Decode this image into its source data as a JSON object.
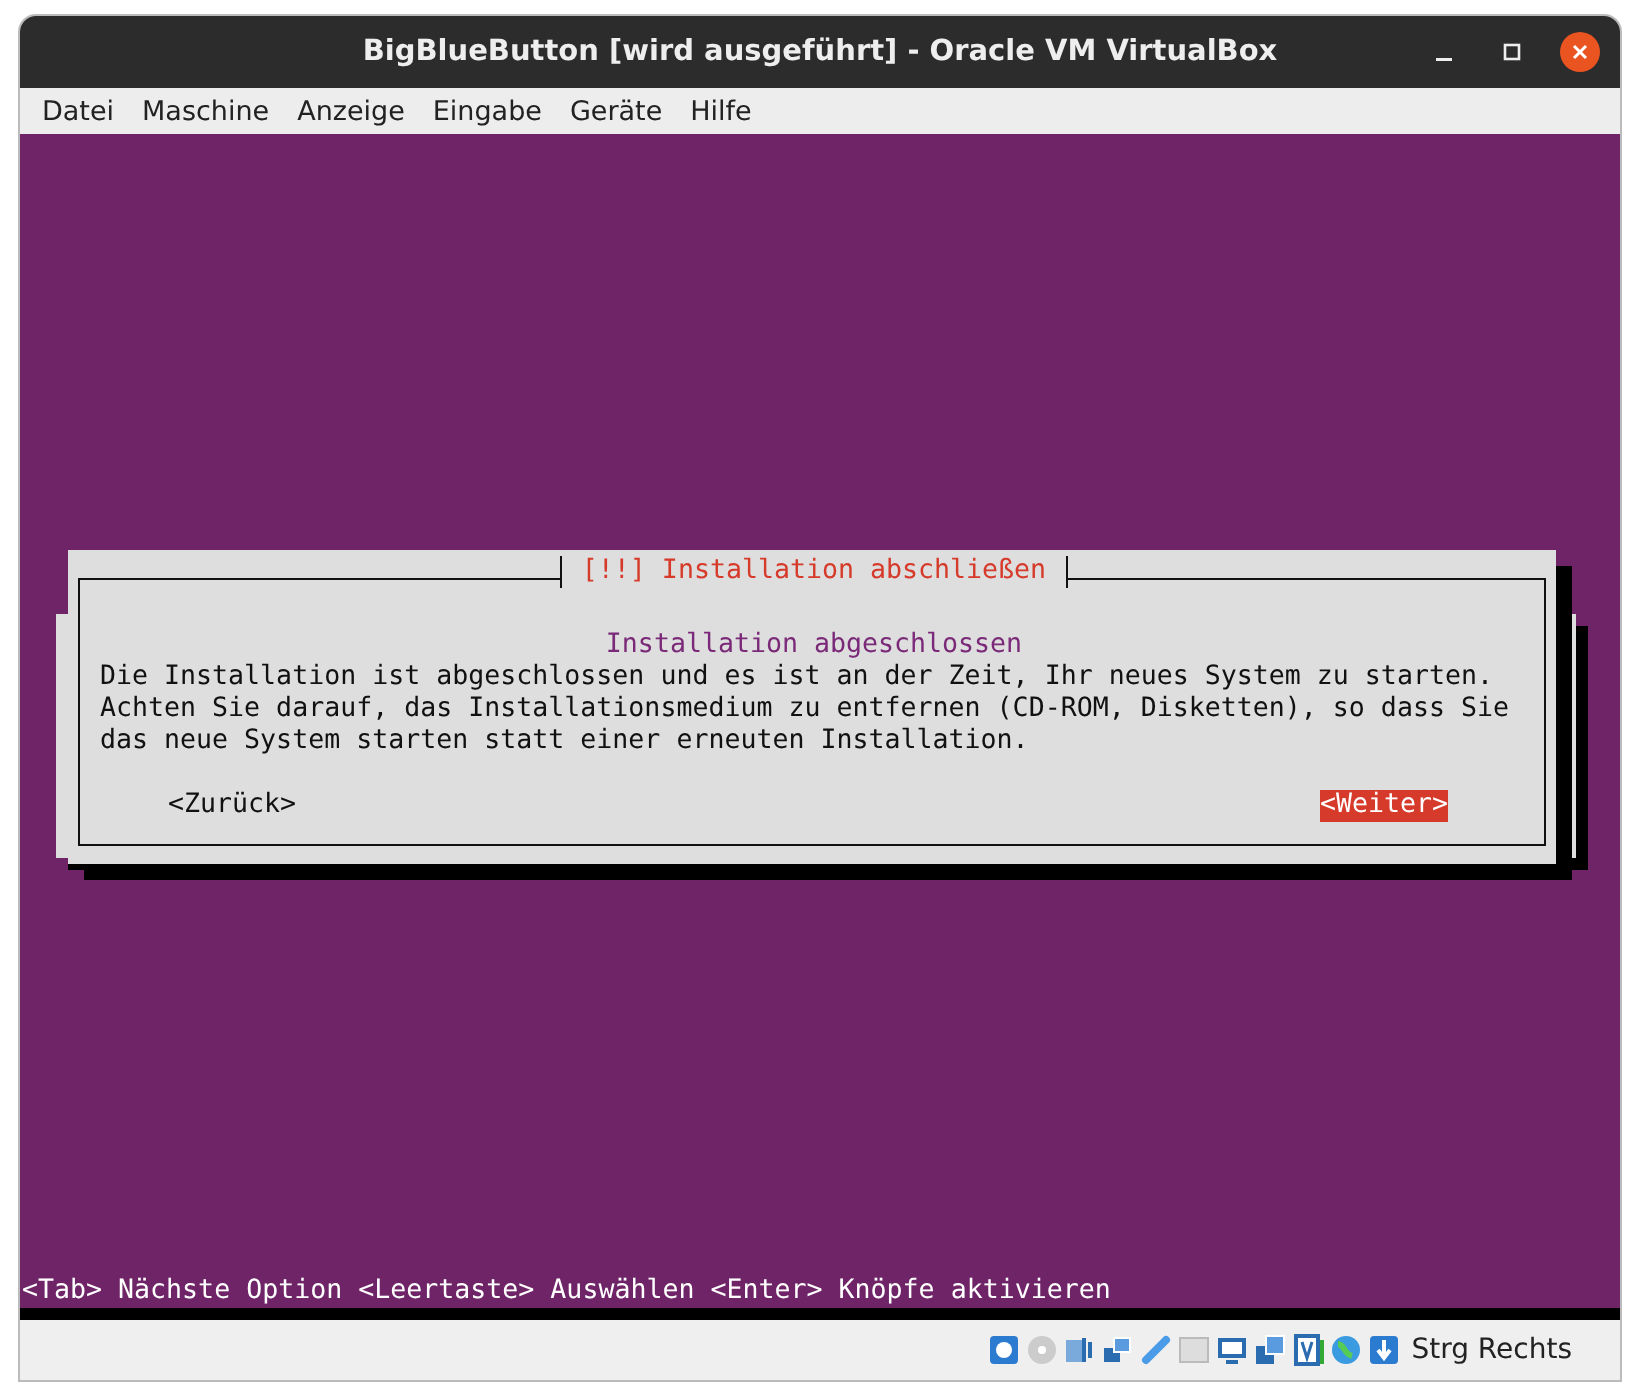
{
  "window": {
    "title": "BigBlueButton [wird ausgeführt] - Oracle VM VirtualBox"
  },
  "menu": [
    "Datei",
    "Maschine",
    "Anzeige",
    "Eingabe",
    "Geräte",
    "Hilfe"
  ],
  "dialog": {
    "title": "[!!] Installation abschließen",
    "heading": "Installation abgeschlossen",
    "lines": [
      "Die Installation ist abgeschlossen und es ist an der Zeit, Ihr neues System zu starten.",
      "Achten Sie darauf, das Installationsmedium zu entfernen (CD-ROM, Disketten), so dass Sie",
      "das neue System starten statt einer erneuten Installation."
    ],
    "buttons": [
      {
        "label": "<Zurück>",
        "selected": false
      },
      {
        "label": "<Weiter>",
        "selected": true
      }
    ]
  },
  "hint": "<Tab> Nächste Option <Leertaste> Auswählen <Enter> Knöpfe aktivieren",
  "status_bar": {
    "host_key": "Strg Rechts"
  }
}
